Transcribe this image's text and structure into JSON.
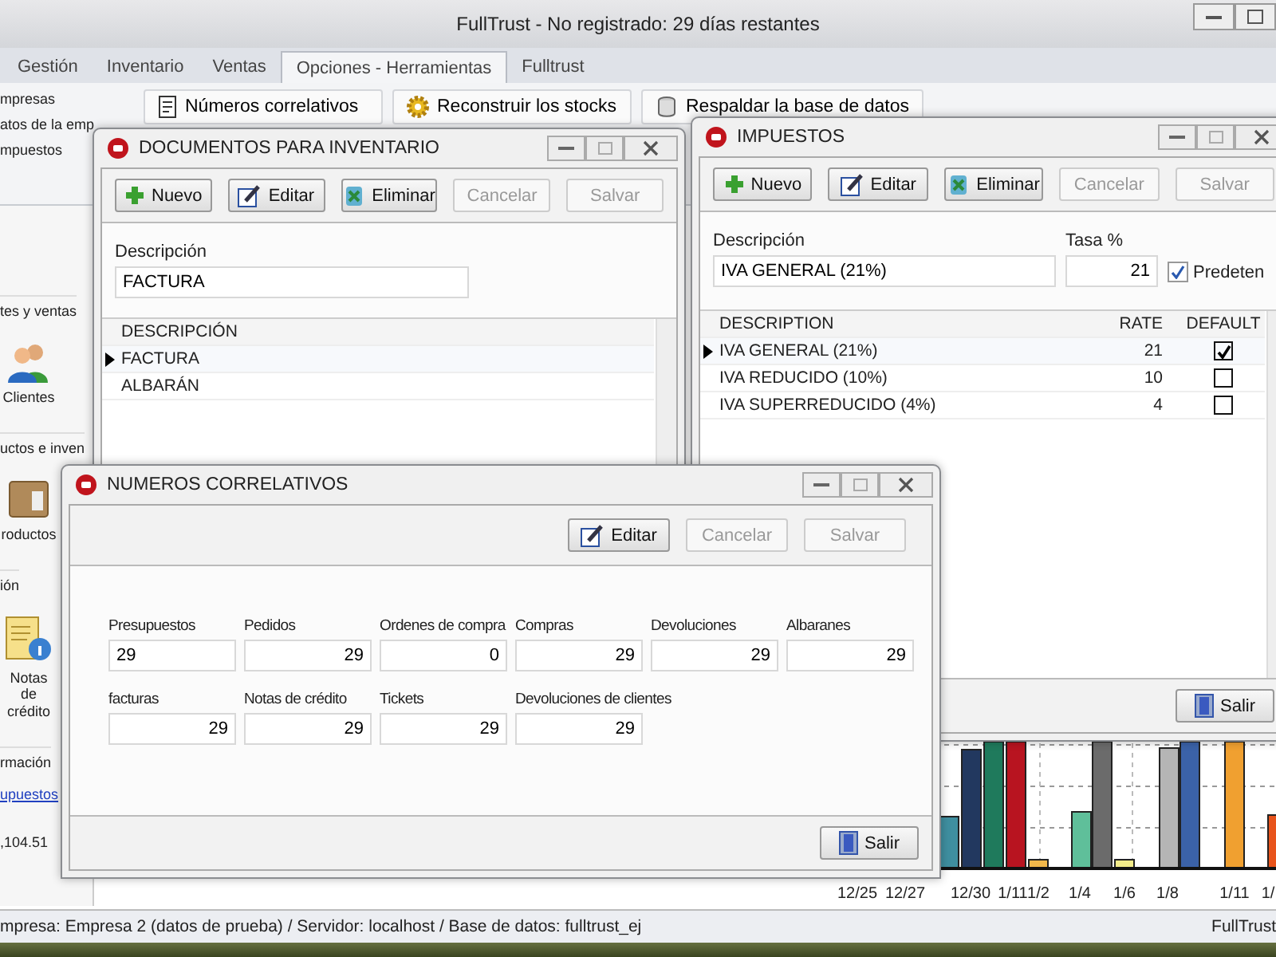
{
  "window": {
    "title": "FullTrust - No registrado: 29 días restantes"
  },
  "tabs": [
    {
      "label": "Gestión",
      "selected": false
    },
    {
      "label": "Inventario",
      "selected": false
    },
    {
      "label": "Ventas",
      "selected": false
    },
    {
      "label": "Opciones - Herramientas",
      "selected": true
    },
    {
      "label": "Fulltrust",
      "selected": false
    }
  ],
  "ribbon": {
    "left_items": [
      "mpresas",
      "atos de la emp",
      "mpuestos"
    ],
    "buttons": [
      {
        "label": "Números correlativos",
        "kind": "document"
      },
      {
        "label": "Reconstruir los stocks",
        "kind": "gear"
      },
      {
        "label": "Respaldar la base de datos",
        "kind": "backup"
      }
    ]
  },
  "sidebar": [
    {
      "kind": "header",
      "text": "tes y ventas"
    },
    {
      "kind": "people",
      "text": "Clientes"
    },
    {
      "kind": "header",
      "text": "uctos e inven"
    },
    {
      "kind": "box",
      "text": "roductos"
    },
    {
      "kind": "header",
      "text": "ión"
    },
    {
      "kind": "note",
      "text": "Notas de crédito"
    },
    {
      "kind": "header",
      "text": "rmación"
    },
    {
      "kind": "link",
      "text": "upuestos"
    },
    {
      "kind": "value",
      "text": ",104.51"
    }
  ],
  "chart": {
    "axis_labels": [
      "12/25",
      "12/27",
      "12/30",
      "1/11",
      "1/2",
      "1/4",
      "1/6",
      "1/8",
      "1/11",
      "1/"
    ]
  },
  "status_bar": {
    "text": "mpresa: Empresa 2 (datos de prueba) / Servidor: localhost / Base de datos: fulltrust_ej",
    "right": "FullTrust"
  },
  "documentos": {
    "title": "DOCUMENTOS PARA INVENTARIO",
    "toolbar": [
      {
        "label": "Nuevo",
        "kind": "add",
        "disabled": false
      },
      {
        "label": "Editar",
        "kind": "edit",
        "disabled": false
      },
      {
        "label": "Eliminar",
        "kind": "delete",
        "disabled": false
      },
      {
        "label": "Cancelar",
        "kind": "plain",
        "disabled": true
      },
      {
        "label": "Salvar",
        "kind": "plain",
        "disabled": true
      }
    ],
    "field_label": "Descripción",
    "field_value": "FACTURA",
    "column": "DESCRIPCIÓN",
    "rows": [
      {
        "text": "FACTURA",
        "selected": true
      },
      {
        "text": "ALBARÁN",
        "selected": false
      }
    ]
  },
  "impuestos": {
    "title": "IMPUESTOS",
    "toolbar": [
      {
        "label": "Nuevo",
        "kind": "add",
        "disabled": false
      },
      {
        "label": "Editar",
        "kind": "edit",
        "disabled": false
      },
      {
        "label": "Eliminar",
        "kind": "delete",
        "disabled": false
      },
      {
        "label": "Cancelar",
        "kind": "plain",
        "disabled": true
      },
      {
        "label": "Salvar",
        "kind": "plain",
        "disabled": true
      }
    ],
    "description_label": "Descripción",
    "description_value": "IVA GENERAL (21%)",
    "rate_label": "Tasa %",
    "rate_value": "21",
    "default_label": "Predeten",
    "default_checked": true,
    "columns": [
      "DESCRIPTION",
      "RATE",
      "DEFAULT"
    ],
    "rows": [
      {
        "description": "IVA GENERAL (21%)",
        "rate": "21",
        "default": true,
        "selected": true
      },
      {
        "description": "IVA REDUCIDO (10%)",
        "rate": "10",
        "default": false,
        "selected": false
      },
      {
        "description": "IVA SUPERREDUCIDO (4%)",
        "rate": "4",
        "default": false,
        "selected": false
      }
    ],
    "exit": "Salir"
  },
  "numeros": {
    "title": "NUMEROS CORRELATIVOS",
    "toolbar": [
      {
        "label": "Editar",
        "kind": "edit",
        "disabled": false
      },
      {
        "label": "Cancelar",
        "kind": "plain",
        "disabled": true
      },
      {
        "label": "Salvar",
        "kind": "plain",
        "disabled": true
      }
    ],
    "fields": [
      {
        "label": "Presupuestos",
        "value": "29",
        "editing": true
      },
      {
        "label": "Pedidos",
        "value": "29",
        "editing": false
      },
      {
        "label": "Ordenes de compra",
        "value": "0",
        "editing": false
      },
      {
        "label": "Compras",
        "value": "29",
        "editing": false
      },
      {
        "label": "Devoluciones",
        "value": "29",
        "editing": false
      },
      {
        "label": "Albaranes",
        "value": "29",
        "editing": false
      },
      {
        "label": "facturas",
        "value": "29",
        "editing": false
      },
      {
        "label": "Notas de crédito",
        "value": "29",
        "editing": false
      },
      {
        "label": "Tickets",
        "value": "29",
        "editing": false
      },
      {
        "label": "Devoluciones de clientes",
        "value": "29",
        "editing": false
      }
    ],
    "exit": "Salir"
  }
}
